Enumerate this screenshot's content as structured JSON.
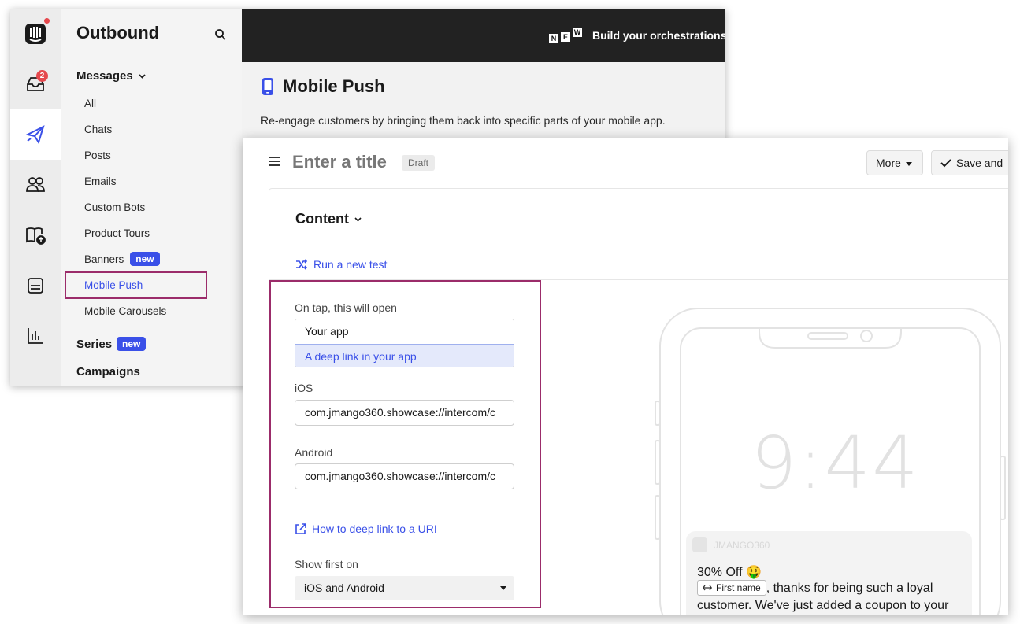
{
  "app": {
    "section_title": "Outbound",
    "inbox_badge": "2"
  },
  "nav": {
    "messages_label": "Messages",
    "items": [
      {
        "label": "All"
      },
      {
        "label": "Chats"
      },
      {
        "label": "Posts"
      },
      {
        "label": "Emails"
      },
      {
        "label": "Custom Bots"
      },
      {
        "label": "Product Tours"
      },
      {
        "label": "Banners",
        "badge": "new"
      },
      {
        "label": "Mobile Push",
        "active": true
      },
      {
        "label": "Mobile Carousels"
      }
    ],
    "series_label": "Series",
    "series_badge": "new",
    "campaigns_label": "Campaigns"
  },
  "topbar": {
    "new_letters": [
      "N",
      "E",
      "W"
    ],
    "text": "Build your orchestrations"
  },
  "page": {
    "title": "Mobile Push",
    "description": "Re-engage customers by bringing them back into specific parts of your mobile app."
  },
  "editor": {
    "title_placeholder": "Enter a title",
    "status": "Draft",
    "more_label": "More",
    "save_label": "Save and",
    "content_label": "Content",
    "run_test_label": "Run a new test",
    "on_tap_label": "On tap, this will open",
    "on_tap_options": [
      "Your app",
      "A deep link in your app"
    ],
    "ios_label": "iOS",
    "ios_value": "com.jmango360.showcase://intercom/c",
    "android_label": "Android",
    "android_value": "com.jmango360.showcase://intercom/c",
    "help_link": "How to deep link to a URI",
    "show_first_label": "Show first on",
    "show_first_value": "iOS and Android"
  },
  "preview": {
    "time": "9:44",
    "app_name": "JMANGO360",
    "notif_title": "30% Off 🤑",
    "attribute_chip": "First name",
    "notif_body_after_chip": ", thanks for being such a loyal customer. We've just added a coupon to your"
  },
  "colors": {
    "accent": "#3a50e8",
    "highlight_border": "#9b2c6a",
    "topbar": "#222222",
    "badge_red": "#e5484d"
  }
}
